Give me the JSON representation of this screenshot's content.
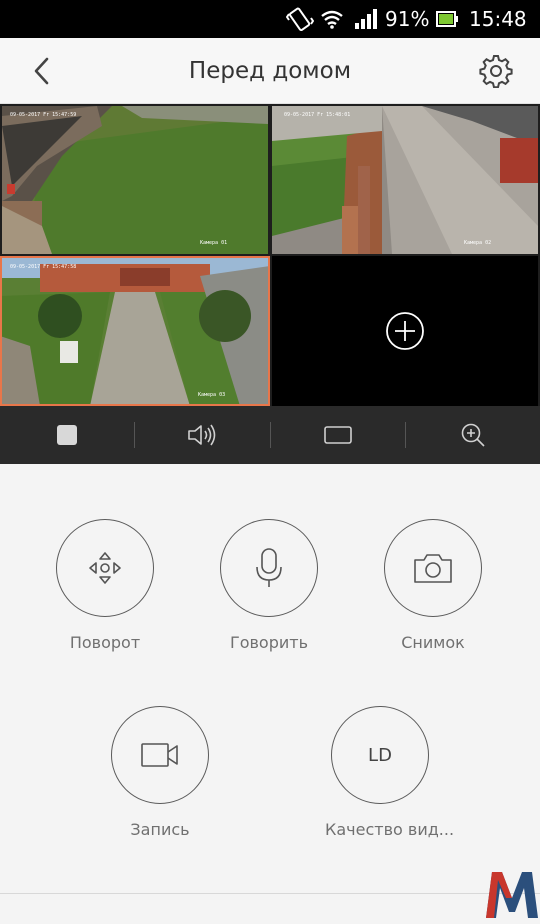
{
  "status_bar": {
    "battery_percent": "91%",
    "time": "15:48",
    "icons": [
      "vibrate-icon",
      "wifi-icon",
      "signal-icon",
      "battery-icon"
    ]
  },
  "header": {
    "title": "Перед домом",
    "back_icon": "back-arrow-icon",
    "settings_icon": "gear-icon"
  },
  "cameras": [
    {
      "timestamp": "09-05-2017 Fr 15:47:59",
      "name": "Камера 01",
      "selected": false
    },
    {
      "timestamp": "09-05-2017 Fr 15:48:01",
      "name": "Камера 02",
      "selected": false
    },
    {
      "timestamp": "09-05-2017 Fr 15:47:58",
      "name": "Камера 03",
      "selected": true
    }
  ],
  "add_camera_icon": "plus-circle-icon",
  "toolbar": {
    "buttons": [
      "stop-icon",
      "speaker-icon",
      "fullscreen-icon",
      "zoom-in-icon"
    ]
  },
  "controls": [
    {
      "label": "Поворот",
      "icon": "ptz-direction-icon"
    },
    {
      "label": "Говорить",
      "icon": "microphone-icon"
    },
    {
      "label": "Снимок",
      "icon": "camera-icon"
    },
    {
      "label": "Запись",
      "icon": "video-camera-icon"
    },
    {
      "label": "Качество вид...",
      "icon": "ld-quality-text",
      "icon_text": "LD"
    }
  ],
  "colors": {
    "selected_border": "#e8764a",
    "status_bar": "#000000",
    "toolbar": "#2a2a2a",
    "battery": "#7ec832"
  }
}
